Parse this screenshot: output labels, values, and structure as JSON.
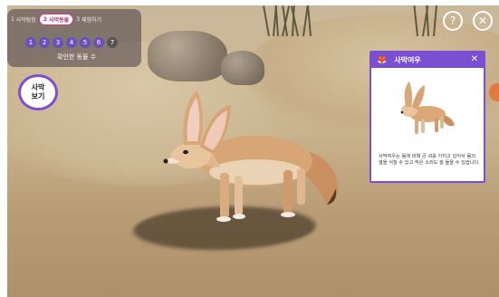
{
  "steps": [
    {
      "num": "1",
      "label": "사막탐험"
    },
    {
      "num": "2",
      "label": "사막동물"
    },
    {
      "num": "3",
      "label": "체험하기"
    }
  ],
  "animal_dots": [
    "1",
    "2",
    "3",
    "4",
    "5",
    "6",
    "7"
  ],
  "count_label": "확인한 동물 수",
  "see_button": {
    "line1": "사막",
    "line2": "보기"
  },
  "help_icon": "?",
  "close_icon": "✕",
  "card": {
    "title": "사막여우",
    "close": "✕",
    "description": "사막여우는 몸에 비해 큰 귀를 가지고 있어서 몸의 열을 식힐 수 있고 작은 소리도 잘 들을 수 있습니다."
  },
  "colors": {
    "accent": "#7a4fd1",
    "step_active": "#d43c8c"
  }
}
